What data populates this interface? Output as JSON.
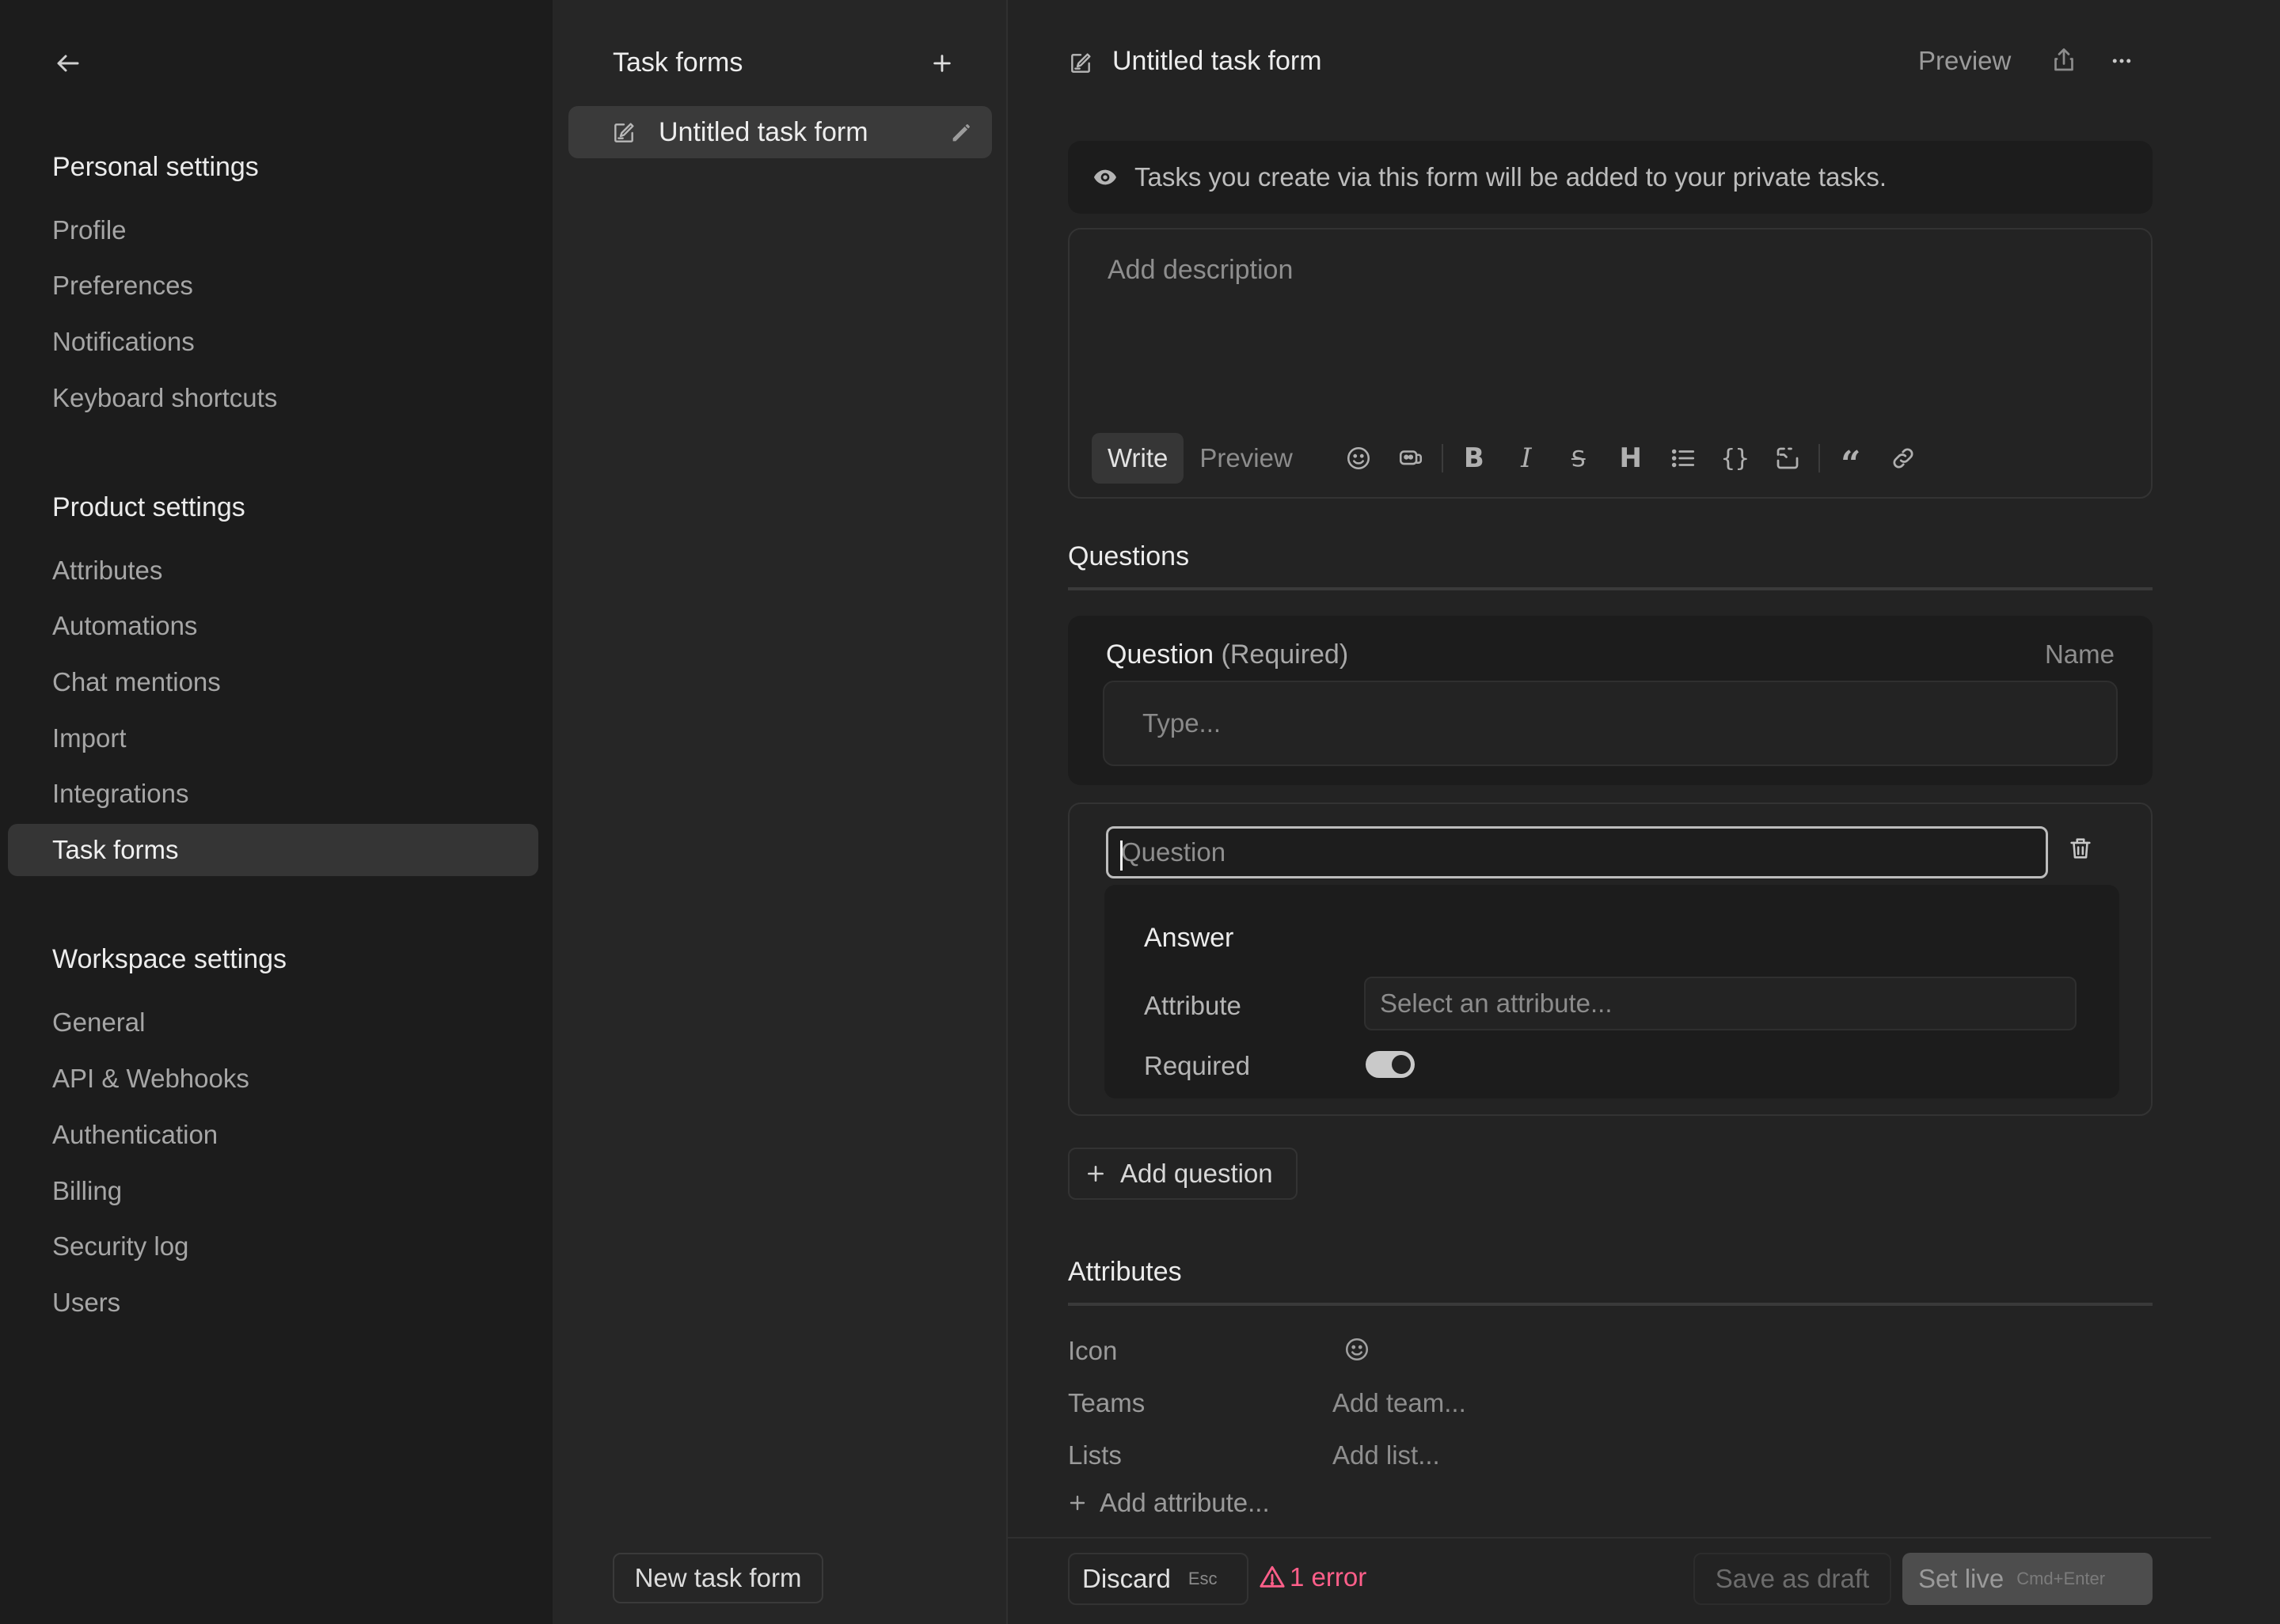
{
  "nav": {
    "personal_title": "Personal settings",
    "personal_items": [
      "Profile",
      "Preferences",
      "Notifications",
      "Keyboard shortcuts"
    ],
    "product_title": "Product settings",
    "product_items": [
      "Attributes",
      "Automations",
      "Chat mentions",
      "Import",
      "Integrations",
      "Task forms"
    ],
    "workspace_title": "Workspace settings",
    "workspace_items": [
      "General",
      "API & Webhooks",
      "Authentication",
      "Billing",
      "Security log",
      "Users"
    ],
    "active_item": "Task forms"
  },
  "list": {
    "title": "Task forms",
    "items": [
      {
        "label": "Untitled task form"
      }
    ],
    "new_button": "New task form"
  },
  "header": {
    "title": "Untitled task form",
    "preview_label": "Preview"
  },
  "notice": "Tasks you create via this form will be added to your private tasks.",
  "description": {
    "placeholder": "Add description",
    "write_tab": "Write",
    "preview_tab": "Preview"
  },
  "questions": {
    "title": "Questions",
    "default_question": {
      "label": "Question",
      "required_tag": "(Required)",
      "name_label": "Name",
      "placeholder": "Type..."
    },
    "editing": {
      "placeholder": "Question",
      "answer_title": "Answer",
      "attribute_label": "Attribute",
      "attribute_placeholder": "Select an attribute...",
      "required_label": "Required",
      "required_on": true
    },
    "add_button": "Add question"
  },
  "attributes": {
    "title": "Attributes",
    "rows": [
      {
        "label": "Icon",
        "value": ""
      },
      {
        "label": "Teams",
        "value": "Add team..."
      },
      {
        "label": "Lists",
        "value": "Add list..."
      }
    ],
    "add_label": "Add attribute..."
  },
  "footer": {
    "discard": "Discard",
    "discard_kbd": "Esc",
    "error_text": "1 error",
    "save_draft": "Save as draft",
    "set_live": "Set live",
    "set_live_kbd": "Cmd+Enter"
  },
  "colors": {
    "error": "#ff5f8a",
    "nav_bg": "#1c1c1c",
    "main_bg": "#232323"
  }
}
